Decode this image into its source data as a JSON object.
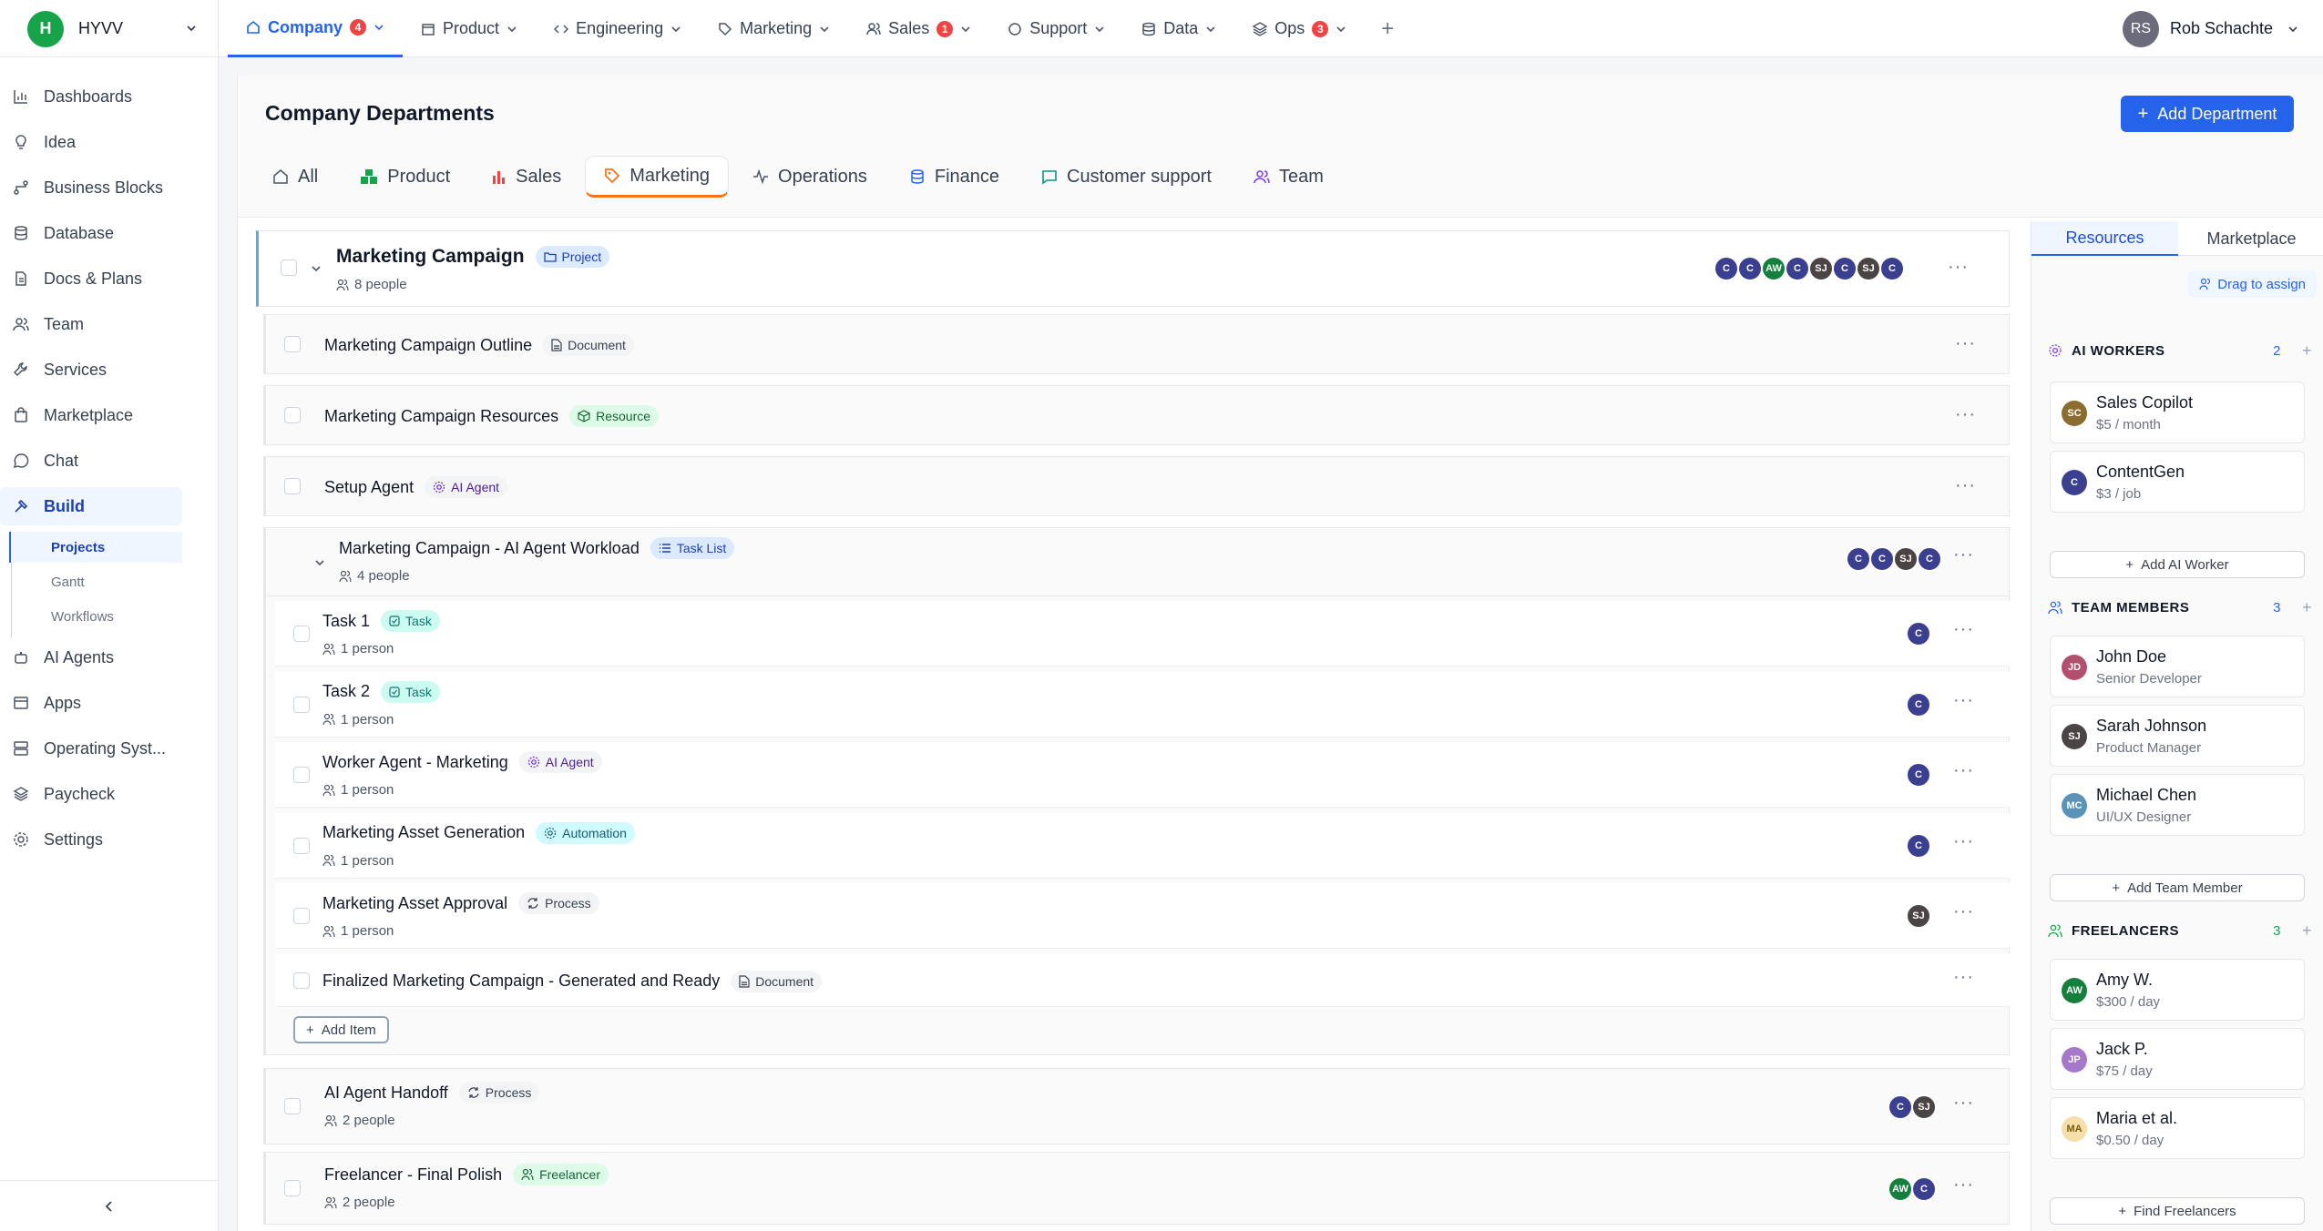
{
  "workspace": {
    "initial": "H",
    "name": "HYVV"
  },
  "topnav": [
    {
      "label": "Company",
      "badge": "4",
      "icon": "home-icon",
      "active": true
    },
    {
      "label": "Product",
      "badge": "",
      "icon": "box-icon"
    },
    {
      "label": "Engineering",
      "badge": "",
      "icon": "code-icon"
    },
    {
      "label": "Marketing",
      "badge": "",
      "icon": "tag-icon"
    },
    {
      "label": "Sales",
      "badge": "1",
      "icon": "users-icon"
    },
    {
      "label": "Support",
      "badge": "",
      "icon": "chat-icon"
    },
    {
      "label": "Data",
      "badge": "",
      "icon": "database-icon"
    },
    {
      "label": "Ops",
      "badge": "3",
      "icon": "layers-icon"
    }
  ],
  "user": {
    "initials": "RS",
    "name": "Rob Schachte"
  },
  "sidebar": {
    "items": [
      {
        "label": "Dashboards",
        "icon": "chart-icon"
      },
      {
        "label": "Idea",
        "icon": "lightbulb-icon"
      },
      {
        "label": "Business Blocks",
        "icon": "workflow-icon"
      },
      {
        "label": "Database",
        "icon": "database-icon"
      },
      {
        "label": "Docs & Plans",
        "icon": "file-icon"
      },
      {
        "label": "Team",
        "icon": "users-icon"
      },
      {
        "label": "Services",
        "icon": "wrench-icon"
      },
      {
        "label": "Marketplace",
        "icon": "bag-icon"
      },
      {
        "label": "Chat",
        "icon": "chat-icon"
      },
      {
        "label": "Build",
        "icon": "hammer-icon"
      },
      {
        "label": "AI Agents",
        "icon": "bot-icon"
      },
      {
        "label": "Apps",
        "icon": "window-icon"
      },
      {
        "label": "Operating Syst...",
        "icon": "server-icon"
      },
      {
        "label": "Paycheck",
        "icon": "layers-icon"
      },
      {
        "label": "Settings",
        "icon": "gear-icon"
      }
    ],
    "sub_items": [
      "Projects",
      "Gantt",
      "Workflows"
    ]
  },
  "page": {
    "title": "Company Departments",
    "add_button": "Add Department"
  },
  "dept_tabs": [
    "All",
    "Product",
    "Sales",
    "Marketing",
    "Operations",
    "Finance",
    "Customer support",
    "Team"
  ],
  "project": {
    "title": "Marketing Campaign",
    "tag": "Project",
    "people": "8 people",
    "avatars": [
      "C",
      "C",
      "AW",
      "C",
      "SJ",
      "C",
      "SJ",
      "C"
    ]
  },
  "items": [
    {
      "title": "Marketing Campaign Outline",
      "tag": "Document"
    },
    {
      "title": "Marketing Campaign Resources",
      "tag": "Resource"
    },
    {
      "title": "Setup Agent",
      "tag": "AI Agent"
    }
  ],
  "workload": {
    "title": "Marketing Campaign - AI Agent Workload",
    "tag": "Task List",
    "people": "4 people",
    "avatars": [
      "C",
      "C",
      "SJ",
      "C"
    ]
  },
  "tasks": [
    {
      "title": "Task 1",
      "tag": "Task",
      "people": "1 person",
      "avatar": "C"
    },
    {
      "title": "Task 2",
      "tag": "Task",
      "people": "1 person",
      "avatar": "C"
    },
    {
      "title": "Worker Agent - Marketing",
      "tag": "AI Agent",
      "people": "1 person",
      "avatar": "C"
    },
    {
      "title": "Marketing Asset Generation",
      "tag": "Automation",
      "people": "1 person",
      "avatar": "C"
    },
    {
      "title": "Marketing Asset Approval",
      "tag": "Process",
      "people": "1 person",
      "avatar": "SJ"
    },
    {
      "title": "Finalized Marketing Campaign - Generated and Ready",
      "tag": "Document",
      "people": "",
      "avatar": ""
    }
  ],
  "add_item_label": "Add Item",
  "bottom_items": [
    {
      "title": "AI Agent Handoff",
      "tag": "Process",
      "people": "2 people",
      "avatars": [
        "C",
        "SJ"
      ]
    },
    {
      "title": "Freelancer - Final Polish",
      "tag": "Freelancer",
      "people": "2 people",
      "avatars": [
        "AW",
        "C"
      ]
    }
  ],
  "right_panel": {
    "tabs": [
      "Resources",
      "Marketplace"
    ],
    "drag_label": "Drag to assign",
    "ai_workers": {
      "title": "AI WORKERS",
      "count": "2",
      "add": "Add AI Worker",
      "cards": [
        {
          "initials": "SC",
          "name": "Sales Copilot",
          "sub": "$5 / month"
        },
        {
          "initials": "C",
          "name": "ContentGen",
          "sub": "$3 / job"
        }
      ]
    },
    "team_members": {
      "title": "TEAM MEMBERS",
      "count": "3",
      "add": "Add Team Member",
      "cards": [
        {
          "initials": "JD",
          "name": "John Doe",
          "sub": "Senior Developer"
        },
        {
          "initials": "SJ",
          "name": "Sarah Johnson",
          "sub": "Product Manager"
        },
        {
          "initials": "MC",
          "name": "Michael Chen",
          "sub": "UI/UX Designer"
        }
      ]
    },
    "freelancers": {
      "title": "FREELANCERS",
      "count": "3",
      "add": "Find Freelancers",
      "cards": [
        {
          "initials": "AW",
          "name": "Amy W.",
          "sub": "$300 / day"
        },
        {
          "initials": "JP",
          "name": "Jack P.",
          "sub": "$75 / day"
        },
        {
          "initials": "MA",
          "name": "Maria et al.",
          "sub": "$0.50 / day"
        }
      ]
    }
  },
  "colors": {
    "accent": "#2563eb",
    "marketing_tab": "#f97316",
    "avatar_c": "#3b3f8f",
    "avatar_sj": "#4b4444",
    "avatar_aw": "#15803d"
  }
}
